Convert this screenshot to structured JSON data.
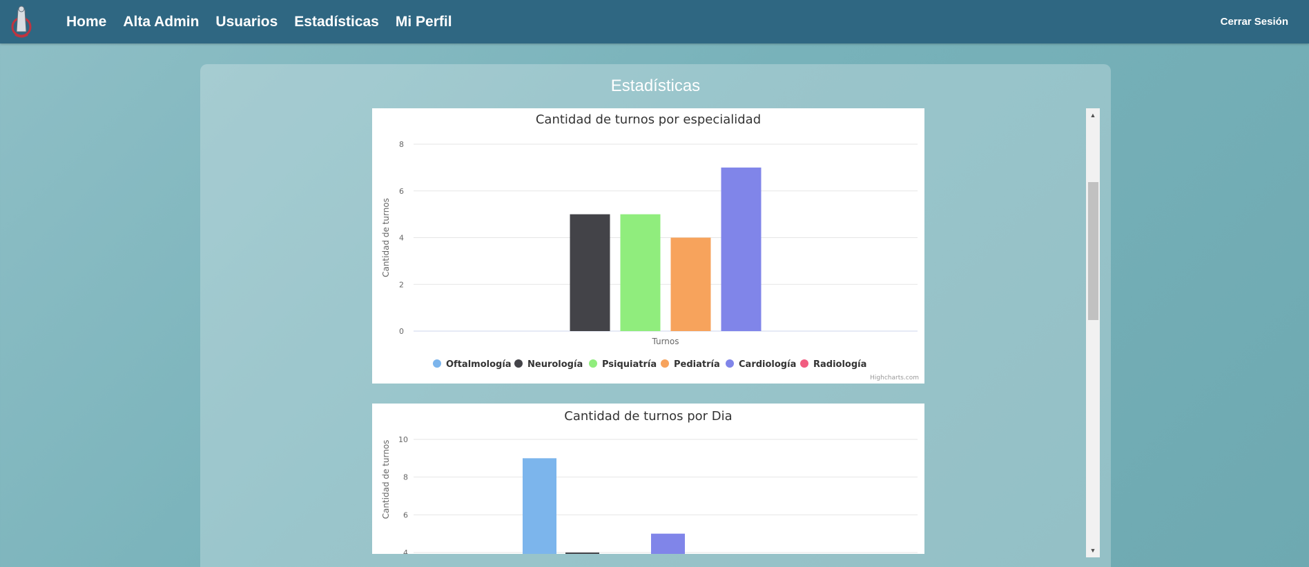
{
  "navbar": {
    "links": [
      "Home",
      "Alta Admin",
      "Usuarios",
      "Estadísticas",
      "Mi Perfil"
    ],
    "logout_label": "Cerrar Sesión",
    "background": "#2f6782",
    "logo_icon": "stethoscope-logo-icon"
  },
  "page": {
    "title": "Estadísticas"
  },
  "scrollbar": {
    "up_icon": "triangle-up-icon",
    "down_icon": "triangle-down-icon"
  },
  "chart_data": [
    {
      "type": "bar",
      "title": "Cantidad de turnos por especialidad",
      "ylabel": "Cantidad de turnos",
      "xlabel": "Turnos",
      "ylim": [
        0,
        8
      ],
      "y_ticks": [
        0,
        2,
        4,
        6,
        8
      ],
      "grid": true,
      "legend_position": "bottom",
      "credit": "Highcharts.com",
      "series": [
        {
          "name": "Oftalmología",
          "value": null,
          "color": "#7cb5ec"
        },
        {
          "name": "Neurología",
          "value": 5,
          "color": "#434348"
        },
        {
          "name": "Psiquiatría",
          "value": 5,
          "color": "#90ed7d"
        },
        {
          "name": "Pediatría",
          "value": 4,
          "color": "#f7a35c"
        },
        {
          "name": "Cardiología",
          "value": 7,
          "color": "#8085e9"
        },
        {
          "name": "Radiología",
          "value": null,
          "color": "#f15c80"
        }
      ]
    },
    {
      "type": "bar",
      "title": "Cantidad de turnos por Dia",
      "ylabel": "Cantidad de turnos",
      "ylim": [
        4,
        10
      ],
      "y_ticks": [
        4,
        6,
        8,
        10
      ],
      "grid": true,
      "series": [
        {
          "value": 9,
          "color": "#7cb5ec"
        },
        {
          "value": 4,
          "color": "#434348"
        },
        {
          "value": null,
          "color": "#90ed7d"
        },
        {
          "value": 5,
          "color": "#8085e9"
        }
      ]
    }
  ]
}
